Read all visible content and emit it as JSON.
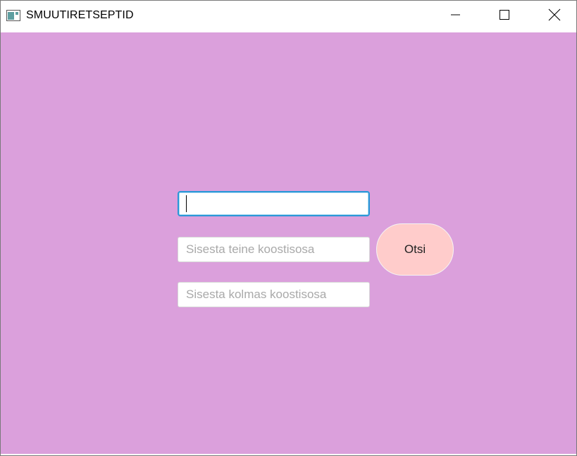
{
  "window": {
    "title": "SMUUTIRETSEPTID",
    "icon": "app-window-icon",
    "controls": {
      "minimize_icon": "minimize-icon",
      "maximize_icon": "maximize-icon",
      "close_icon": "close-icon"
    }
  },
  "form": {
    "ingredient1": {
      "value": "",
      "placeholder": ""
    },
    "ingredient2": {
      "value": "",
      "placeholder": "Sisesta teine koostisosa"
    },
    "ingredient3": {
      "value": "",
      "placeholder": "Sisesta kolmas koostisosa"
    },
    "search_label": "Otsi"
  },
  "colors": {
    "background": "#dba0dc",
    "button": "#ffcccb",
    "focus_border": "#2b97d7"
  }
}
